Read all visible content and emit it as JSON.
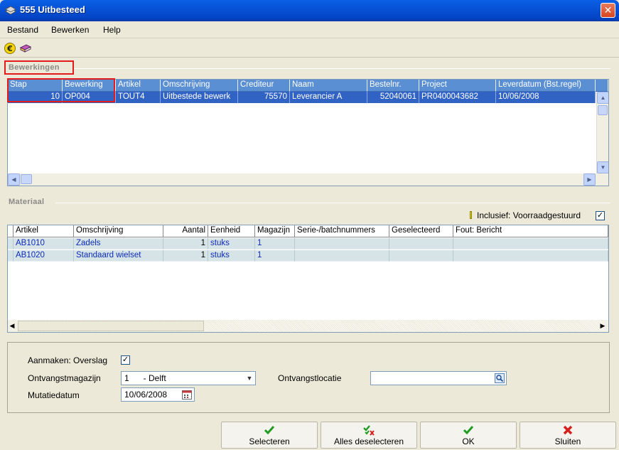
{
  "window": {
    "title": "555 Uitbesteed",
    "close_symbol": "✕"
  },
  "menu": [
    {
      "label": "Bestand",
      "underline": "B"
    },
    {
      "label": "Bewerken",
      "underline": "w"
    },
    {
      "label": "Help",
      "underline": "H"
    }
  ],
  "toolbar": [
    {
      "icon": "euro-icon"
    },
    {
      "icon": "book-icon"
    }
  ],
  "bewerkingen": {
    "section_label": "Bewerkingen",
    "columns": [
      "Stap",
      "Bewerking",
      "Artikel",
      "Omschrijving",
      "Crediteur",
      "Naam",
      "Bestelnr.",
      "Project",
      "Leverdatum (Bst.regel)"
    ],
    "rows": [
      [
        "10",
        "OP004",
        "TOUT4",
        "Uitbestede bewerk",
        "75570",
        "Leverancier A",
        "52040061",
        "PR0400043682",
        "10/06/2008"
      ]
    ]
  },
  "materiaal": {
    "section_label": "Materiaal",
    "inclusief_label": "Inclusief: Voorraadgestuurd",
    "inclusief_checked": "✓",
    "columns": [
      "Artikel",
      "Omschrijving",
      "Aantal",
      "Eenheid",
      "Magazijn",
      "Serie-/batchnummers",
      "Geselecteerd",
      "Fout: Bericht"
    ],
    "rows": [
      [
        "AB1010",
        "Zadels",
        "1",
        "stuks",
        "1",
        "",
        "",
        ""
      ],
      [
        "AB1020",
        "Standaard wielset",
        "1",
        "stuks",
        "1",
        "",
        "",
        ""
      ]
    ]
  },
  "form": {
    "aanmaken_label": "Aanmaken: Overslag",
    "aanmaken_checked": "✓",
    "ontvangstmagazijn_label": "Ontvangstmagazijn",
    "ontvangstmagazijn_value": "1      - Delft",
    "ontvangstlocatie_label": "Ontvangstlocatie",
    "ontvangstlocatie_value": "",
    "mutatiedatum_label": "Mutatiedatum",
    "mutatiedatum_value": "10/06/2008"
  },
  "buttons": {
    "selecteren": "Selecteren",
    "alles_deselecteren": "Alles deselecteren",
    "ok": "OK",
    "sluiten": "Sluiten"
  },
  "colors": {
    "titlebar": "#0751d6",
    "grid_header": "#5a8fd4",
    "row_selected": "#3163c5",
    "material_row": "#d6e4e8",
    "highlight_box": "#e31b1b",
    "check_green": "#1f9c1f",
    "close_red": "#d6201e"
  }
}
